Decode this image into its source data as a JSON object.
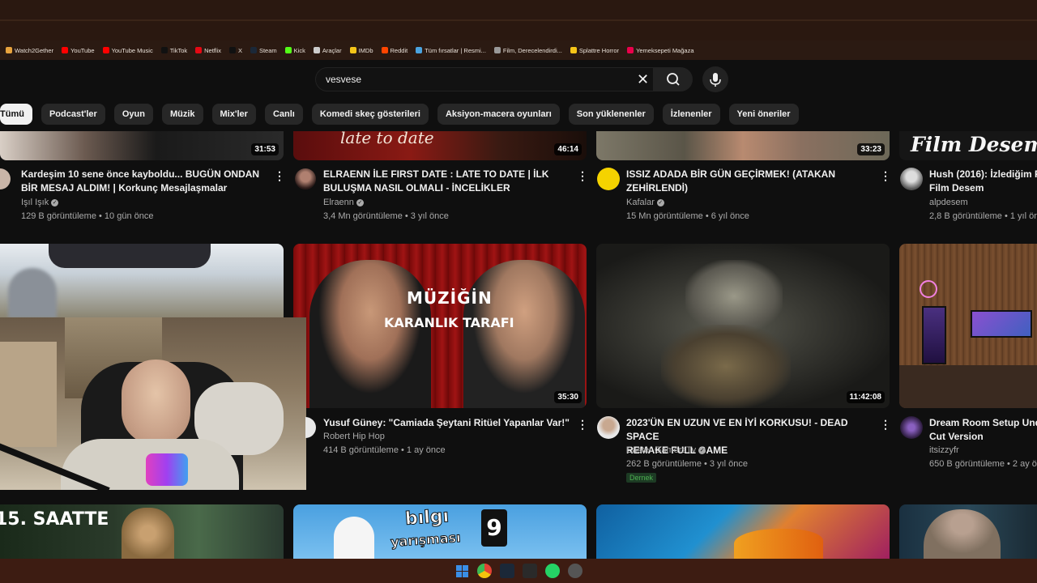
{
  "bookmarks": [
    {
      "label": "Watch2Gether",
      "color": "#e8a33d"
    },
    {
      "label": "YouTube",
      "color": "#ff0000"
    },
    {
      "label": "YouTube Music",
      "color": "#ff0000"
    },
    {
      "label": "TikTok",
      "color": "#111111"
    },
    {
      "label": "Netflix",
      "color": "#e50914"
    },
    {
      "label": "X",
      "color": "#111111"
    },
    {
      "label": "Steam",
      "color": "#1b2838"
    },
    {
      "label": "Kick",
      "color": "#53fc18"
    },
    {
      "label": "Araçlar",
      "color": "#cccccc"
    },
    {
      "label": "IMDb",
      "color": "#f5c518"
    },
    {
      "label": "Reddit",
      "color": "#ff4500"
    },
    {
      "label": "Tüm fırsatlar | Resmi...",
      "color": "#4aa3df"
    },
    {
      "label": "Film, Derecelendirdi...",
      "color": "#999999"
    },
    {
      "label": "Splattre Horror",
      "color": "#f5c518"
    },
    {
      "label": "Yemeksepeti Mağaza",
      "color": "#ea004b"
    }
  ],
  "search": {
    "value": "vesvese"
  },
  "chips": [
    "Tümü",
    "Podcast'ler",
    "Oyun",
    "Müzik",
    "Mix'ler",
    "Canlı",
    "Komedi skeç gösterileri",
    "Aksiyon-macera oyunları",
    "Son yüklenenler",
    "İzlenenler",
    "Yeni öneriler"
  ],
  "row1": [
    {
      "duration": "31:53",
      "title1": "Kardeşim 10 sene önce kayboldu... BUGÜN ONDAN",
      "title2": "BİR MESAJ ALDIM! | Korkunç Mesajlaşmalar",
      "channel": "Işıl Işık",
      "meta": "129 B görüntüleme • 10 gün önce"
    },
    {
      "duration": "46:14",
      "title1": "ELRAENN İLE FIRST DATE : LATE TO DATE | İLK",
      "title2": "BULUŞMA NASIL OLMALI - İNCELİKLER",
      "channel": "Elraenn",
      "meta": "3,4 Mn görüntüleme • 3 yıl önce"
    },
    {
      "duration": "33:23",
      "title1": "ISSIZ ADADA BİR GÜN GEÇİRMEK! (ATAKAN",
      "title2": "ZEHİRLENDİ)",
      "channel": "Kafalar",
      "meta": "15 Mn görüntüleme • 6 yıl önce"
    },
    {
      "duration": "",
      "title1": "Hush (2016): İzlediğim F",
      "title2": "Film Desem",
      "channel": "alpdesem",
      "meta": "2,8 B görüntüleme • 1 yıl ön"
    }
  ],
  "row1_thumb_text": {
    "t2": "late to date",
    "t4": "Film Desem"
  },
  "row2": [
    {
      "duration": "",
      "title1": "",
      "title2": "",
      "channel": "",
      "meta": ""
    },
    {
      "duration": "35:30",
      "title1": "Yusuf Güney: \"Camiada Şeytani Ritüel Yapanlar Var!\"",
      "title2": "",
      "channel": "Robert Hip Hop",
      "meta": "414 B görüntüleme • 1 ay önce"
    },
    {
      "duration": "11:42:08",
      "title1": "2023'ÜN EN UZUN VE EN İYİ KORKUSU! - DEAD SPACE",
      "title2": "REMAKE FULL GAME",
      "channel": "Easter GamersTv",
      "meta": "262 B görüntüleme • 3 yıl önce",
      "badge": "Dernek"
    },
    {
      "duration": "",
      "title1": "Dream Room Setup Und",
      "title2": "Cut Version",
      "channel": "itsizzyfr",
      "meta": "650 B görüntüleme • 2 ay ön"
    }
  ],
  "row2_thumb_text": {
    "line1": "MÜZİĞİN",
    "line2": "KARANLIK TARAFI"
  },
  "row3_thumb_text": {
    "t1": "15. SAATTE",
    "t2a": "bılgı",
    "t2b": "yarışması",
    "t2c": "9"
  },
  "taskbar": [
    {
      "name": "windows-start-icon",
      "color": "#3a8ee6"
    },
    {
      "name": "chrome-icon",
      "color": "#e34133"
    },
    {
      "name": "steam-icon",
      "color": "#1b2838"
    },
    {
      "name": "epic-icon",
      "color": "#2a2a2a"
    },
    {
      "name": "whatsapp-icon",
      "color": "#25d366"
    },
    {
      "name": "app-icon",
      "color": "#555555"
    }
  ]
}
